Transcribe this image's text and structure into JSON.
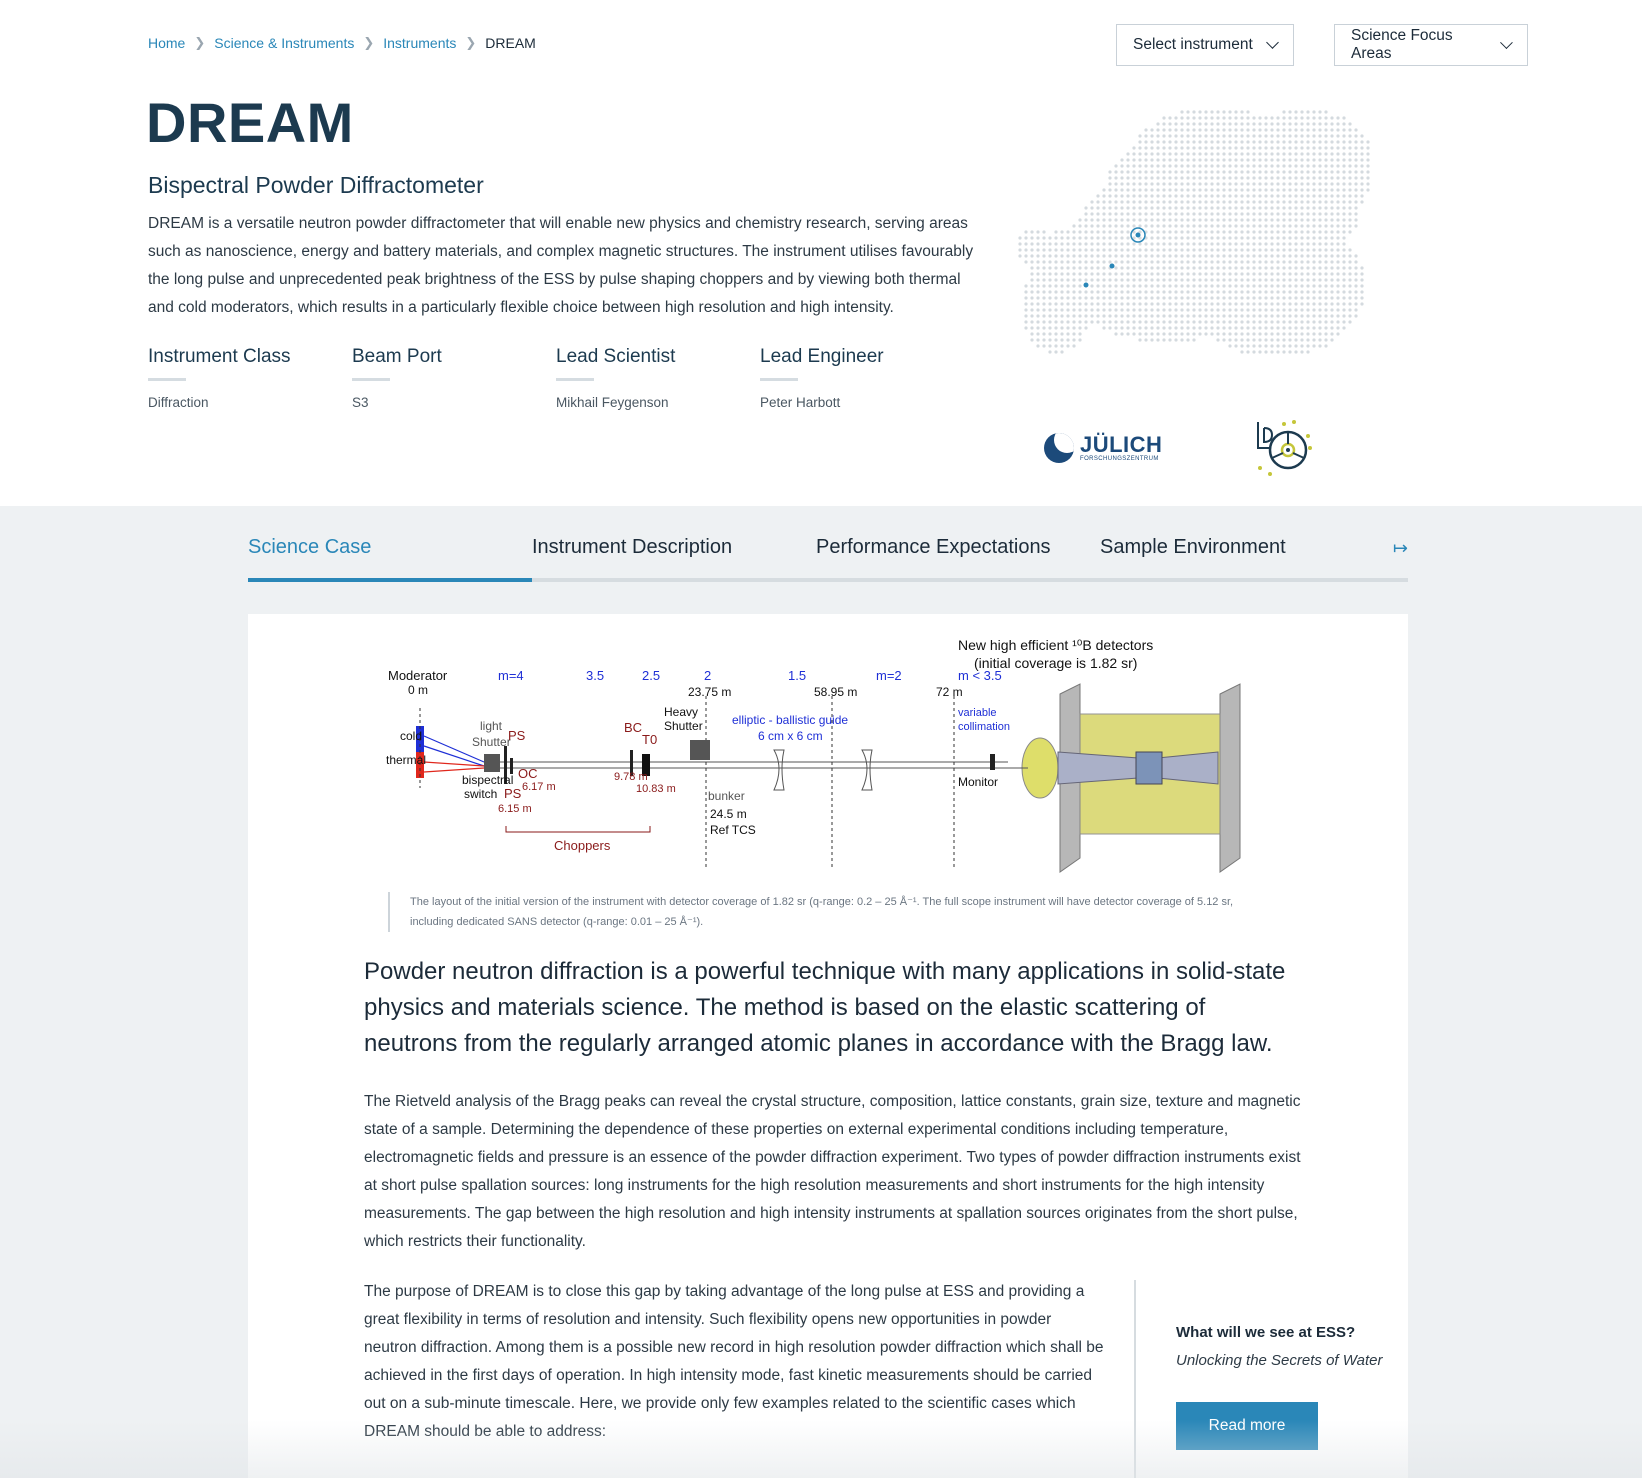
{
  "breadcrumb": {
    "items": [
      "Home",
      "Science & Instruments",
      "Instruments"
    ],
    "current": "DREAM"
  },
  "dropdowns": {
    "instrument": "Select instrument",
    "focus": "Science Focus Areas"
  },
  "header": {
    "title": "DREAM",
    "subtitle": "Bispectral Powder Diffractometer",
    "intro": "DREAM is a versatile neutron powder diffractometer that will enable new physics and chemistry research, serving areas such as nanoscience, energy and battery materials, and complex magnetic structures. The instrument utilises favourably the long pulse and unprecedented peak brightness of the ESS by pulse shaping choppers and by viewing both thermal and cold moderators, which results in a particularly flexible choice between high resolution and high intensity."
  },
  "facts": [
    {
      "label": "Instrument Class",
      "value": "Diffraction"
    },
    {
      "label": "Beam Port",
      "value": "S3"
    },
    {
      "label": "Lead Scientist",
      "value": "Mikhail Feygenson"
    },
    {
      "label": "Lead Engineer",
      "value": "Peter Harbott"
    }
  ],
  "partners": {
    "juelich_name": "JÜLICH",
    "juelich_sub": "FORSCHUNGSZENTRUM"
  },
  "tabs": [
    "Science Case",
    "Instrument Description",
    "Performance Expectations",
    "Sample Environment"
  ],
  "active_tab": "Science Case",
  "figure": {
    "detectors_line1": "New high efficient ¹⁰B detectors",
    "detectors_line2": "(initial coverage is 1.82 sr)",
    "moderator": "Moderator",
    "zero": "0 m",
    "cold": "cold",
    "thermal": "thermal",
    "light_shutter_1": "light",
    "light_shutter_2": "Shutter",
    "bispectral_1": "bispectral",
    "bispectral_2": "switch",
    "ps": "PS",
    "oc": "OC",
    "ps_dist": "6.15 m",
    "oc_dist": "6.17 m",
    "bc": "BC",
    "t0": "T0",
    "bc_dist": "9.78 m",
    "t0_dist": "10.83 m",
    "choppers": "Choppers",
    "heavy_1": "Heavy",
    "heavy_2": "Shutter",
    "guide_1": "elliptic - ballistic guide",
    "guide_2": "6 cm x 6 cm",
    "bunker": "bunker",
    "ref_dist": "24.5 m",
    "ref_tcs": "Ref TCS",
    "m_values": [
      "m=4",
      "3.5",
      "2.5",
      "2",
      "1.5",
      "m=2",
      "m < 3.5"
    ],
    "d1": "23.75 m",
    "d2": "58.95 m",
    "d3": "72 m",
    "collim_1": "variable",
    "collim_2": "collimation",
    "monitor": "Monitor"
  },
  "caption": "The layout of the initial version of the instrument with detector coverage of 1.82 sr (q-range: 0.2 – 25 Å⁻¹. The full scope instrument will have detector coverage of 5.12 sr, including dedicated SANS detector (q-range: 0.01 – 25 Å⁻¹).",
  "content": {
    "lead": "Powder neutron diffraction is a powerful technique with many applications in solid-state physics and materials science. The method is based on the elastic scattering of neutrons from the regularly arranged atomic planes in accordance with the Bragg law.",
    "p1": "The Rietveld analysis of the Bragg peaks can reveal the crystal structure, composition, lattice constants, grain size, texture and magnetic state of a sample.  Determining the dependence of these properties on external experimental conditions including temperature, electromagnetic fields and pressure is an essence of the powder diffraction experiment. Two types of powder diffraction instruments exist at short pulse spallation sources: long instruments for the high resolution measurements and short instruments for the high intensity measurements. The gap between the high resolution and high intensity instruments at spallation sources originates from the short pulse, which restricts their functionality.",
    "p2": "The purpose of DREAM is to close this gap by taking advantage of the long pulse at ESS and providing a great flexibility in terms of resolution and intensity. Such flexibility opens new opportunities in powder neutron diffraction. Among them is a possible new record in high resolution powder diffraction which shall be achieved in the first days of operation. In high intensity mode, fast kinetic measurements should be carried out on a sub-minute timescale. Here, we provide only few examples related to the scientific cases which DREAM should be able to address:"
  },
  "aside": {
    "title": "What will we see at ESS?",
    "subtitle": "Unlocking the Secrets of Water",
    "button": "Read more"
  },
  "colors": {
    "accent": "#2a87b8",
    "heading": "#1c3a4f",
    "band": "#eef1f3"
  },
  "icons": [
    "chevron-right-icon",
    "chevron-down-icon",
    "tab-scroll-arrow-icon",
    "europe-map-icon",
    "juelich-logo-icon",
    "lbr-logo-icon"
  ]
}
